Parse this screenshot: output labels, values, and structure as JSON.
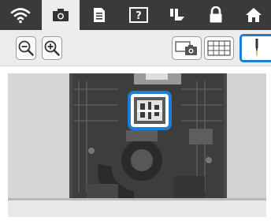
{
  "colors": {
    "accent": "#1c7fd6",
    "topbar": "#3a3a3a",
    "active_tab": "#ededed",
    "toolbar": "#ececec"
  },
  "top_tabs": [
    {
      "icon": "wifi-icon",
      "active": false
    },
    {
      "icon": "camera-icon",
      "active": true
    },
    {
      "icon": "document-icon",
      "active": false
    },
    {
      "icon": "help-icon",
      "active": false
    },
    {
      "icon": "sewing-foot-icon",
      "active": false
    },
    {
      "icon": "lock-icon",
      "active": false
    },
    {
      "icon": "home-icon",
      "active": false
    }
  ],
  "help_tab": {
    "glyph": "?"
  },
  "toolbar": {
    "zoom_out_icon": "zoom-out-icon",
    "zoom_in_icon": "zoom-in-icon",
    "camera_view_icon": "camera-view-icon",
    "grid_icon": "grid-icon",
    "needle_icon": "needle-icon",
    "needle_selected": true
  },
  "camera_view": {
    "content": "needle-plate-photo",
    "highlight": "presser-foot-area"
  }
}
